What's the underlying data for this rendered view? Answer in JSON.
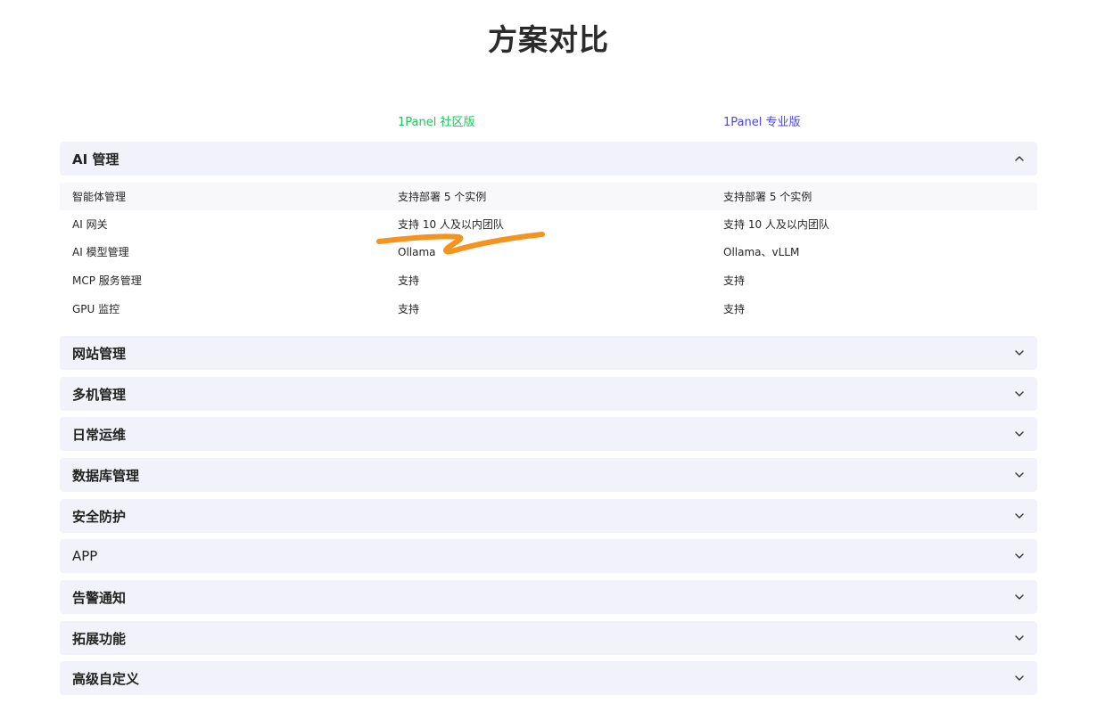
{
  "page": {
    "title": "方案对比"
  },
  "columns": {
    "community": "1Panel 社区版",
    "pro": "1Panel 专业版"
  },
  "expanded_section": {
    "label": "AI 管理",
    "rows": [
      {
        "feature": "智能体管理",
        "community": "支持部署 5 个实例",
        "pro": "支持部署 5 个实例"
      },
      {
        "feature": "AI 网关",
        "community": "支持 10 人及以内团队",
        "pro": "支持 10 人及以内团队"
      },
      {
        "feature": "AI 模型管理",
        "community": "Ollama",
        "pro": "Ollama、vLLM"
      },
      {
        "feature": "MCP 服务管理",
        "community": "支持",
        "pro": "支持"
      },
      {
        "feature": "GPU 监控",
        "community": "支持",
        "pro": "支持"
      }
    ]
  },
  "collapsed_sections": [
    {
      "label": "网站管理"
    },
    {
      "label": "多机管理"
    },
    {
      "label": "日常运维"
    },
    {
      "label": "数据库管理"
    },
    {
      "label": "安全防护"
    },
    {
      "label": "APP"
    },
    {
      "label": "告警通知"
    },
    {
      "label": "拓展功能"
    },
    {
      "label": "高级自定义"
    }
  ],
  "colors": {
    "community": "#22c55e",
    "pro": "#4f46e5",
    "highlight_stroke": "#f5931e",
    "section_bg": "#f2f3fa"
  },
  "icons": {
    "expanded": "chevron-up-icon",
    "collapsed": "chevron-down-icon"
  }
}
